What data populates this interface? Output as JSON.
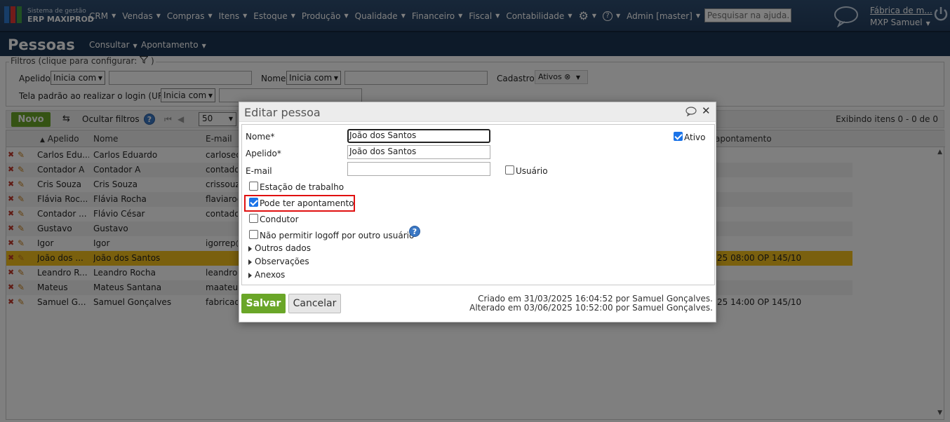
{
  "app": {
    "brand_line1": "Sistema de gestão",
    "brand_line2": "ERP MAXIPROD",
    "menu": [
      "CRM",
      "Vendas",
      "Compras",
      "Itens",
      "Estoque",
      "Produção",
      "Qualidade",
      "Financeiro",
      "Fiscal",
      "Contabilidade"
    ],
    "admin_label": "Admin [master]",
    "help_search_placeholder": "Pesquisar na ajuda...",
    "company": "Fábrica de m...",
    "user": "MXP Samuel"
  },
  "page": {
    "title": "Pessoas",
    "menu": [
      "Consultar",
      "Apontamento"
    ]
  },
  "filters": {
    "legend": "Filtros (clique para configurar:",
    "legend_close": ")",
    "apelido_label": "Apelido",
    "apelido_mode": "Inicia com",
    "nome_label": "Nome",
    "nome_mode": "Inicia com",
    "cadastro_label": "Cadastro",
    "cadastro_tag": "Ativos",
    "tela_label": "Tela padrão ao realizar o login (URL)",
    "tela_mode": "Inicia com"
  },
  "toolbar": {
    "novo": "Novo",
    "ocultar": "Ocultar filtros",
    "page_size": "50",
    "showing": "Exibindo itens 0 - 0 de 0"
  },
  "grid": {
    "columns": [
      "Apelido",
      "Nome",
      "E-mail",
      "apontamento"
    ],
    "rows": [
      {
        "apelido": "Carlos Edu...",
        "nome": "Carlos Eduardo",
        "email": "carlosed",
        "apont": ""
      },
      {
        "apelido": "Contador A",
        "nome": "Contador A",
        "email": "contador",
        "apont": ""
      },
      {
        "apelido": "Cris Souza",
        "nome": "Cris Souza",
        "email": "crissouza",
        "apont": ""
      },
      {
        "apelido": "Flávia Roc...",
        "nome": "Flávia Rocha",
        "email": "flaviaroc",
        "apont": ""
      },
      {
        "apelido": "Contador ...",
        "nome": "Flávio César",
        "email": "contador",
        "apont": ""
      },
      {
        "apelido": "Gustavo",
        "nome": "Gustavo",
        "email": "",
        "apont": ""
      },
      {
        "apelido": "Igor",
        "nome": "Igor",
        "email": "igorrep@",
        "apont": ""
      },
      {
        "apelido": "João dos ...",
        "nome": "João dos Santos",
        "email": "",
        "apont": "25 08:00 OP 145/10"
      },
      {
        "apelido": "Leandro R...",
        "nome": "Leandro Rocha",
        "email": "leandror",
        "apont": ""
      },
      {
        "apelido": "Mateus",
        "nome": "Mateus Santana",
        "email": "maateus",
        "apont": ""
      },
      {
        "apelido": "Samuel G...",
        "nome": "Samuel Gonçalves",
        "email": "fabricad",
        "apont": "25 14:00 OP 145/10"
      }
    ]
  },
  "modal": {
    "title": "Editar pessoa",
    "nome_label": "Nome*",
    "nome_value": "João dos Santos",
    "apelido_label": "Apelido*",
    "apelido_value": "João dos Santos",
    "email_label": "E-mail",
    "email_value": "",
    "ativo_label": "Ativo",
    "ativo_checked": true,
    "usuario_label": "Usuário",
    "usuario_checked": false,
    "estacao_label": "Estação de trabalho",
    "estacao_checked": false,
    "apontamento_label": "Pode ter apontamento",
    "apontamento_checked": true,
    "condutor_label": "Condutor",
    "condutor_checked": false,
    "logoff_label": "Não permitir logoff por outro usuário",
    "logoff_checked": false,
    "sections": [
      "Outros dados",
      "Observações",
      "Anexos"
    ],
    "salvar": "Salvar",
    "cancelar": "Cancelar",
    "criado": "Criado em 31/03/2025 16:04:52 por Samuel Gonçalves.",
    "alterado": "Alterado em 03/06/2025 10:52:00 por Samuel Gonçalves."
  },
  "colors": {
    "topbar": "#2f4e72",
    "header": "#1b3552",
    "accent_green": "#6aa628",
    "selected_row": "#f5c11c",
    "highlight_red": "#e01010",
    "checkbox_blue": "#1a73e8"
  }
}
